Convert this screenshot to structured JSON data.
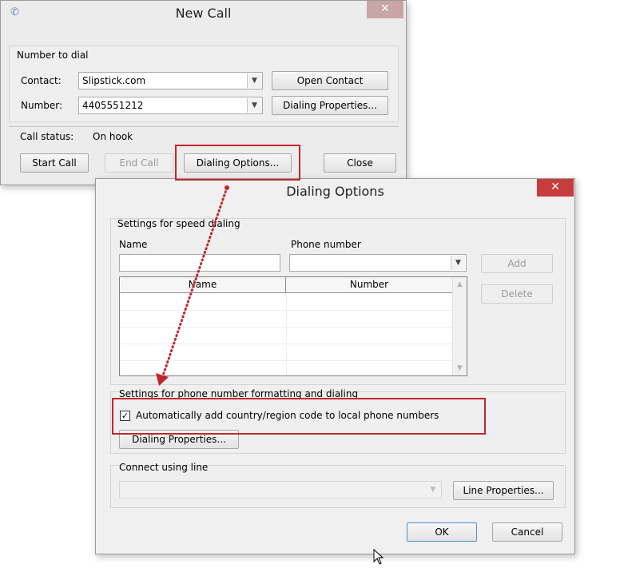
{
  "new_call": {
    "title": "New Call",
    "group_label": "Number to dial",
    "contact_label": "Contact:",
    "contact_value": "Slipstick.com",
    "number_label": "Number:",
    "number_value": "4405551212",
    "open_contact": "Open Contact",
    "dialing_properties": "Dialing Properties...",
    "call_status_label": "Call status:",
    "call_status_value": "On hook",
    "start_call": "Start Call",
    "end_call": "End Call",
    "dialing_options": "Dialing Options...",
    "close": "Close"
  },
  "dialing_options": {
    "title": "Dialing Options",
    "speed_group": "Settings for speed dialing",
    "name_label": "Name",
    "phone_label": "Phone number",
    "name_value": "",
    "phone_value": "",
    "add": "Add",
    "delete": "Delete",
    "columns": [
      "Name",
      "Number"
    ],
    "format_group": "Settings for phone number formatting and dialing",
    "auto_add_checked": true,
    "auto_add_label": "Automatically add country/region code to local phone numbers",
    "dialing_properties": "Dialing Properties...",
    "line_group": "Connect using line",
    "line_value": "",
    "line_properties": "Line Properties...",
    "ok": "OK",
    "cancel": "Cancel"
  },
  "colors": {
    "highlight": "#c0282e",
    "close_active": "#c73d3d",
    "close_inactive": "#c8a6a6"
  }
}
